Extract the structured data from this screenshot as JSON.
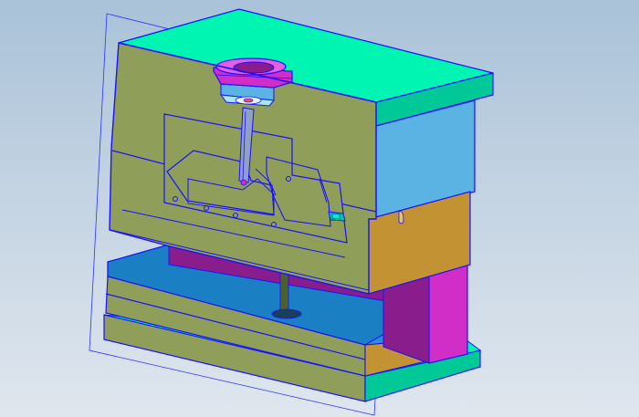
{
  "viewport": {
    "background_top": "#a9c2d8",
    "background_bottom": "#dfe6ee"
  },
  "model": {
    "description": "",
    "colors": {
      "top_plate": "#00f5b2",
      "plate_front": "#8f9f5a",
      "plate_side_blue": "#5ab3e3",
      "plate_side_gold": "#c39333",
      "plate_side_magenta": "#d12ec7",
      "ejector_blue": "#1b80c3",
      "ejector_purple": "#8a1d8c",
      "edge": "#1a10ff",
      "selection_outline": "#2a33ff"
    }
  }
}
